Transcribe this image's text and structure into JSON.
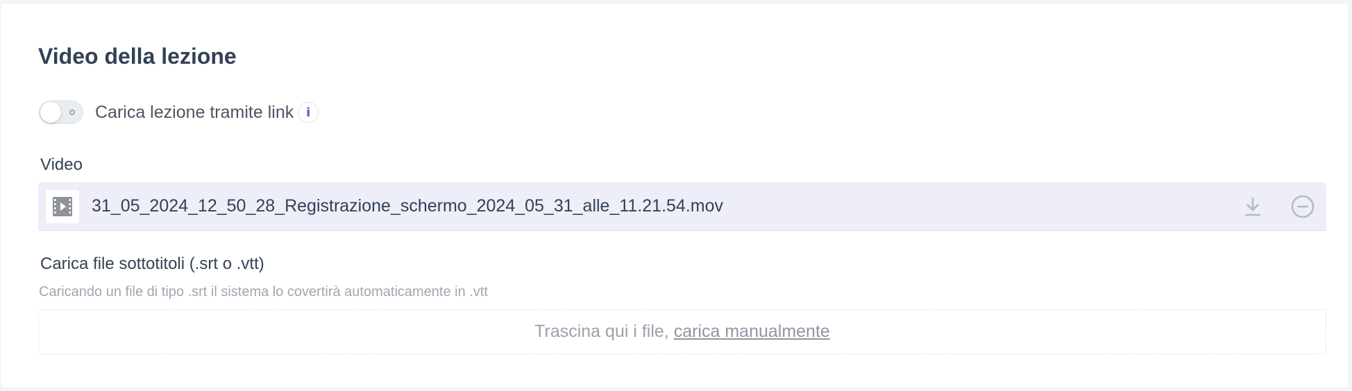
{
  "section": {
    "title": "Video della lezione"
  },
  "link_toggle": {
    "label": "Carica lezione tramite link",
    "enabled": false,
    "info_glyph": "i"
  },
  "video": {
    "label": "Video",
    "file_name": "31_05_2024_12_50_28_Registrazione_schermo_2024_05_31_alle_11.21.54.mov",
    "file_icon": "video-file-icon",
    "actions": [
      "download-icon",
      "remove-icon"
    ]
  },
  "subtitles": {
    "label": "Carica file sottotitoli (.srt o .vtt)",
    "hint": "Caricando un file di tipo .srt il sistema lo covertirà automaticamente in .vtt",
    "dropzone_text": "Trascina qui i file, ",
    "dropzone_link": "carica manualmente"
  },
  "colors": {
    "accent": "#5b5bd6",
    "file_row_bg": "#eeeef9",
    "heading": "#334155"
  }
}
